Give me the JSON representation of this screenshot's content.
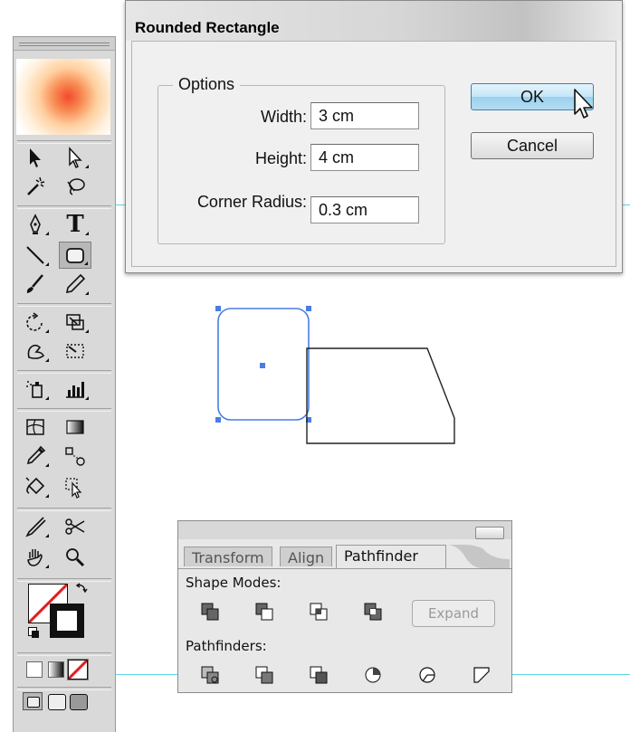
{
  "dialog": {
    "title": "Rounded Rectangle",
    "options_label": "Options",
    "width_label": "Width:",
    "width_value": "3 cm",
    "height_label": "Height:",
    "height_value": "4 cm",
    "radius_label": "Corner Radius:",
    "radius_value": "0.3 cm",
    "ok_label": "OK",
    "cancel_label": "Cancel"
  },
  "tools_panel": {
    "tools": [
      "selection-tool",
      "direct-selection-tool",
      "magic-wand-tool",
      "lasso-tool",
      "pen-tool",
      "type-tool",
      "line-segment-tool",
      "rounded-rectangle-tool",
      "paintbrush-tool",
      "pencil-tool",
      "rotate-tool",
      "scale-tool",
      "warp-tool",
      "free-transform-tool",
      "symbol-sprayer-tool",
      "column-graph-tool",
      "mesh-tool",
      "gradient-tool",
      "eyedropper-tool",
      "blend-tool",
      "live-paint-bucket-tool",
      "live-paint-selection-tool",
      "scissors-knife-tool",
      "scissors-tool",
      "hand-tool",
      "zoom-tool"
    ],
    "selected_tool": "rounded-rectangle-tool",
    "type_tool_glyph": "T"
  },
  "pathfinder": {
    "tabs": [
      "Transform",
      "Align",
      "Pathfinder"
    ],
    "active_tab": "Pathfinder",
    "shape_modes_label": "Shape Modes:",
    "pathfinders_label": "Pathfinders:",
    "expand_label": "Expand"
  },
  "colors": {
    "selection_blue": "#4a7de0",
    "guide_cyan": "#5fd4e6",
    "ok_button_blue": "#98d1ef"
  }
}
